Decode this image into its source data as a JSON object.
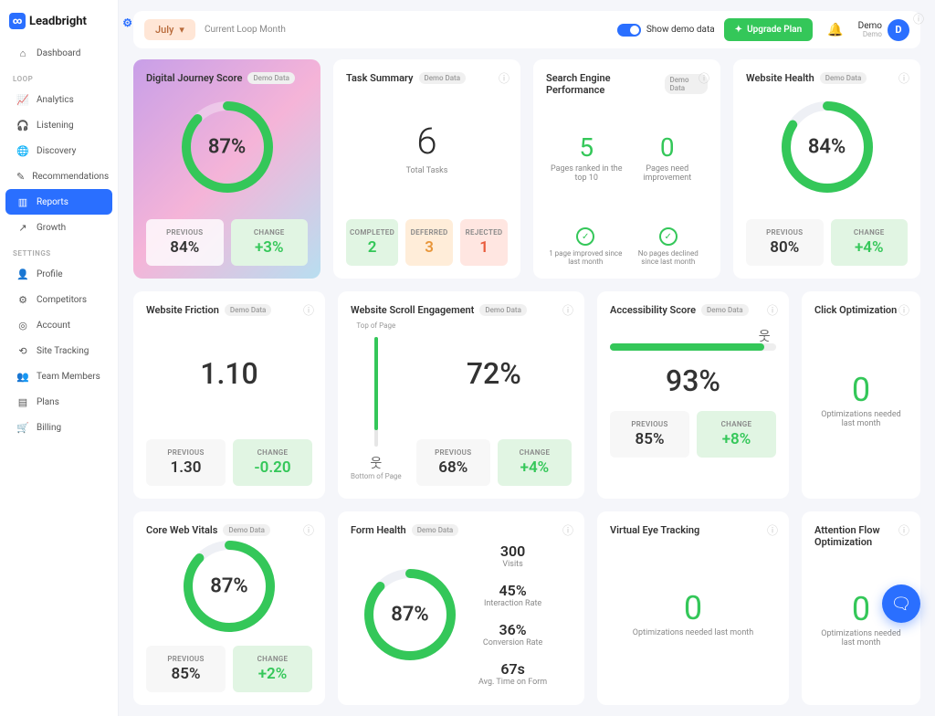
{
  "brand": "Leadbright",
  "topbar": {
    "month": "July",
    "loop_label": "Current Loop Month",
    "demo_label": "Show demo data",
    "upgrade": "Upgrade Plan",
    "user_name": "Demo",
    "user_sub": "Demo",
    "user_initial": "D"
  },
  "sidebar": {
    "dashboard": "Dashboard",
    "section_loop": "LOOP",
    "section_settings": "SETTINGS",
    "loop_items": [
      {
        "label": "Analytics"
      },
      {
        "label": "Listening"
      },
      {
        "label": "Discovery"
      },
      {
        "label": "Recommendations"
      },
      {
        "label": "Reports"
      },
      {
        "label": "Growth"
      }
    ],
    "settings_items": [
      {
        "label": "Profile"
      },
      {
        "label": "Competitors"
      },
      {
        "label": "Account"
      },
      {
        "label": "Site Tracking"
      },
      {
        "label": "Team Members"
      },
      {
        "label": "Plans"
      },
      {
        "label": "Billing"
      }
    ]
  },
  "badges": {
    "demo": "Demo Data"
  },
  "labels": {
    "previous": "PREVIOUS",
    "change": "CHANGE",
    "completed": "COMPLETED",
    "deferred": "DEFERRED",
    "rejected": "REJECTED",
    "top_page": "Top of Page",
    "bottom_page": "Bottom of Page"
  },
  "cards": {
    "djs": {
      "title": "Digital Journey Score",
      "pct": "87%",
      "prev": "84%",
      "change": "+3%"
    },
    "task": {
      "title": "Task Summary",
      "total": "6",
      "total_label": "Total Tasks",
      "completed": "2",
      "deferred": "3",
      "rejected": "1"
    },
    "sep": {
      "title": "Search Engine Performance",
      "ranked": "5",
      "ranked_desc": "Pages ranked in the top 10",
      "need": "0",
      "need_desc": "Pages need improvement",
      "improved": "1 page improved since last month",
      "declined": "No pages declined since last month"
    },
    "health": {
      "title": "Website Health",
      "pct": "84%",
      "prev": "80%",
      "change": "+4%"
    },
    "friction": {
      "title": "Website Friction",
      "score": "1.10",
      "prev": "1.30",
      "change": "-0.20"
    },
    "scroll": {
      "title": "Website Scroll Engagement",
      "pct": "72%",
      "prev": "68%",
      "change": "+4%"
    },
    "access": {
      "title": "Accessibility Score",
      "pct": "93%",
      "prev": "85%",
      "change": "+8%",
      "fill": 93
    },
    "click": {
      "title": "Click Optimization",
      "count": "0",
      "desc": "Optimizations needed last month"
    },
    "cwv": {
      "title": "Core Web Vitals",
      "pct": "87%",
      "prev": "85%",
      "change": "+2%"
    },
    "form": {
      "title": "Form Health",
      "pct": "87%",
      "visits": "300",
      "visits_l": "Visits",
      "inter": "45%",
      "inter_l": "Interaction Rate",
      "conv": "36%",
      "conv_l": "Conversion Rate",
      "time": "67s",
      "time_l": "Avg. Time on Form"
    },
    "vet": {
      "title": "Virtual Eye Tracking",
      "count": "0",
      "desc": "Optimizations needed last month"
    },
    "afo": {
      "title": "Attention Flow Optimization",
      "count": "0",
      "desc": "Optimizations needed last month"
    }
  },
  "colors": {
    "accent": "#2a6fff",
    "success": "#34c759"
  }
}
